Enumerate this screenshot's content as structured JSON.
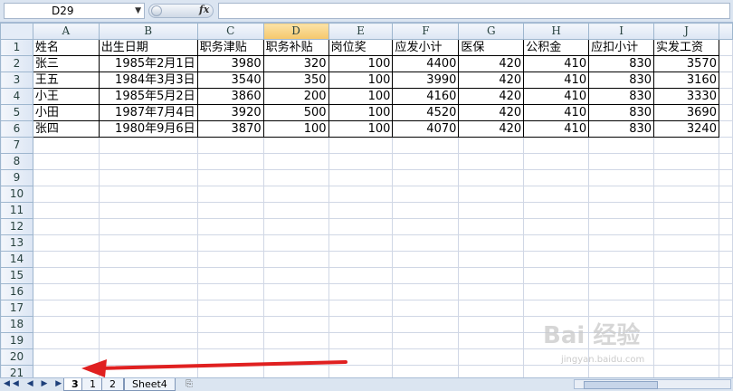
{
  "formula_bar": {
    "name_box": "D29",
    "fx_label": "fx",
    "formula": ""
  },
  "columns": [
    "A",
    "B",
    "C",
    "D",
    "E",
    "F",
    "G",
    "H",
    "I",
    "J"
  ],
  "selected_column": "D",
  "rows": [
    "1",
    "2",
    "3",
    "4",
    "5",
    "6",
    "7",
    "8",
    "9",
    "10",
    "11",
    "12",
    "13",
    "14",
    "15",
    "16",
    "17",
    "18",
    "19",
    "20",
    "21"
  ],
  "table": {
    "headers": [
      "姓名",
      "出生日期",
      "职务津贴",
      "职务补贴",
      "岗位奖",
      "应发小计",
      "医保",
      "公积金",
      "应扣小计",
      "实发工资"
    ],
    "records": [
      [
        "张三",
        "1985年2月1日",
        "3980",
        "320",
        "100",
        "4400",
        "420",
        "410",
        "830",
        "3570"
      ],
      [
        "王五",
        "1984年3月3日",
        "3540",
        "350",
        "100",
        "3990",
        "420",
        "410",
        "830",
        "3160"
      ],
      [
        "小王",
        "1985年5月2日",
        "3860",
        "200",
        "100",
        "4160",
        "420",
        "410",
        "830",
        "3330"
      ],
      [
        "小田",
        "1987年7月4日",
        "3920",
        "500",
        "100",
        "4520",
        "420",
        "410",
        "830",
        "3690"
      ],
      [
        "张四",
        "1980年9月6日",
        "3870",
        "100",
        "100",
        "4070",
        "420",
        "410",
        "830",
        "3240"
      ]
    ]
  },
  "sheet_tabs": [
    "3",
    "1",
    "2",
    "Sheet4"
  ],
  "active_tab": "3",
  "watermark": {
    "main": "Bai 经验",
    "sub": "jingyan.baidu.com"
  },
  "colors": {
    "selected_header": "#f5c76b",
    "arrow": "#e02020",
    "grid": "#d0d7e5"
  }
}
